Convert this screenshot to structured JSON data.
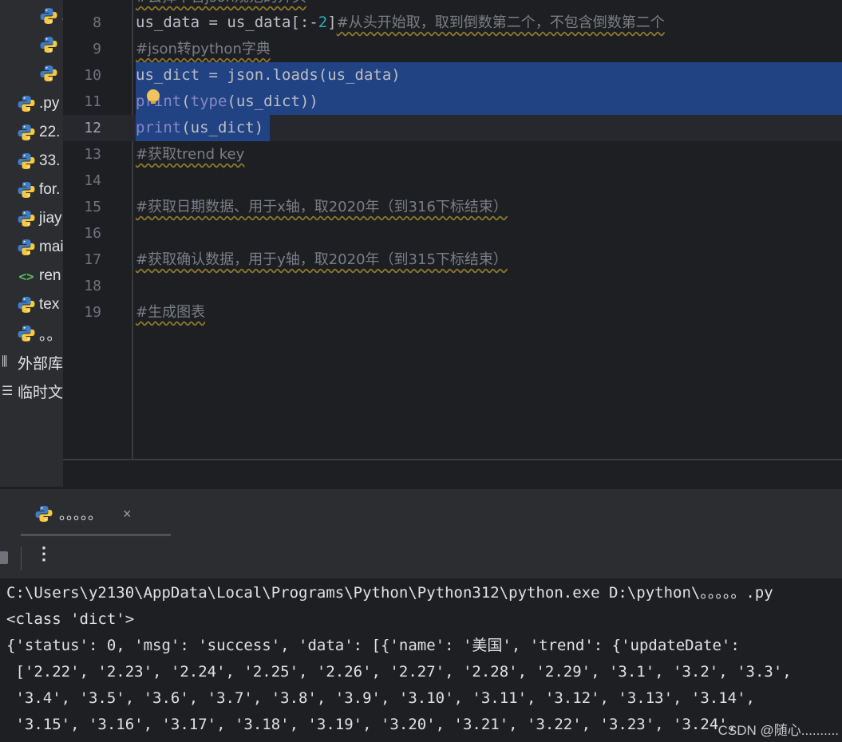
{
  "project_tree": {
    "items": [
      {
        "icon": "python-file-icon",
        "label": "."
      },
      {
        "icon": "python-file-icon",
        "label": ""
      },
      {
        "icon": "python-file-icon",
        "label": ""
      },
      {
        "icon": "python-file-icon",
        "label": ".py"
      },
      {
        "icon": "python-file-icon",
        "label": "22."
      },
      {
        "icon": "python-file-icon",
        "label": "33."
      },
      {
        "icon": "python-file-icon",
        "label": "for."
      },
      {
        "icon": "python-file-icon",
        "label": "jiay"
      },
      {
        "icon": "python-file-icon",
        "label": "mai"
      },
      {
        "icon": "html-file-icon",
        "label": "ren"
      },
      {
        "icon": "python-file-icon",
        "label": "tex"
      },
      {
        "icon": "python-file-icon",
        "label": "。。"
      }
    ],
    "external_libraries": "外部库",
    "scratches": "临时文"
  },
  "editor": {
    "top_partial": "#去掉不合json规范的开头",
    "lines": [
      {
        "num": "8",
        "p1": "us_data = us_data[:-",
        "n": "2",
        "p2": "]",
        "comment": "#从头开始取，取到倒数第二个，不包含倒数第二个"
      },
      {
        "num": "9",
        "comment": "#json转python字典"
      },
      {
        "num": "10",
        "code": "us_dict = json.loads(us_data)"
      },
      {
        "num": "11",
        "kw1": "print",
        "mid": "(",
        "kw2": "type",
        "rest": "(us_dict))"
      },
      {
        "num": "12",
        "kw1": "print",
        "rest": "(us_dict)"
      },
      {
        "num": "13",
        "comment": "#获取trend key"
      },
      {
        "num": "14"
      },
      {
        "num": "15",
        "comment": "#获取日期数据、用于x轴，取2020年（到316下标结束）"
      },
      {
        "num": "16"
      },
      {
        "num": "17",
        "comment": "#获取确认数据，用于y轴，取2020年（到315下标结束）"
      },
      {
        "num": "18"
      },
      {
        "num": "19",
        "comment": "#生成图表"
      }
    ]
  },
  "run": {
    "tab_label": "。。。。。",
    "close": "×",
    "more": "⋮",
    "output": [
      "C:\\Users\\y2130\\AppData\\Local\\Programs\\Python\\Python312\\python.exe D:\\python\\。。。。。.py",
      "<class 'dict'>",
      "{'status': 0, 'msg': 'success', 'data': [{'name': '美国', 'trend': {'updateDate':",
      " ['2.22', '2.23', '2.24', '2.25', '2.26', '2.27', '2.28', '2.29', '3.1', '3.2', '3.3',",
      " '3.4', '3.5', '3.6', '3.7', '3.8', '3.9', '3.10', '3.11', '3.12', '3.13', '3.14',",
      " '3.15', '3.16', '3.17', '3.18', '3.19', '3.20', '3.21', '3.22', '3.23', '3.24',"
    ]
  },
  "watermark": "CSDN @随心..........",
  "colors": {
    "selection": "#214283",
    "comment": "#7a7e85",
    "number": "#2aacb8",
    "builtin": "#8888c6"
  }
}
